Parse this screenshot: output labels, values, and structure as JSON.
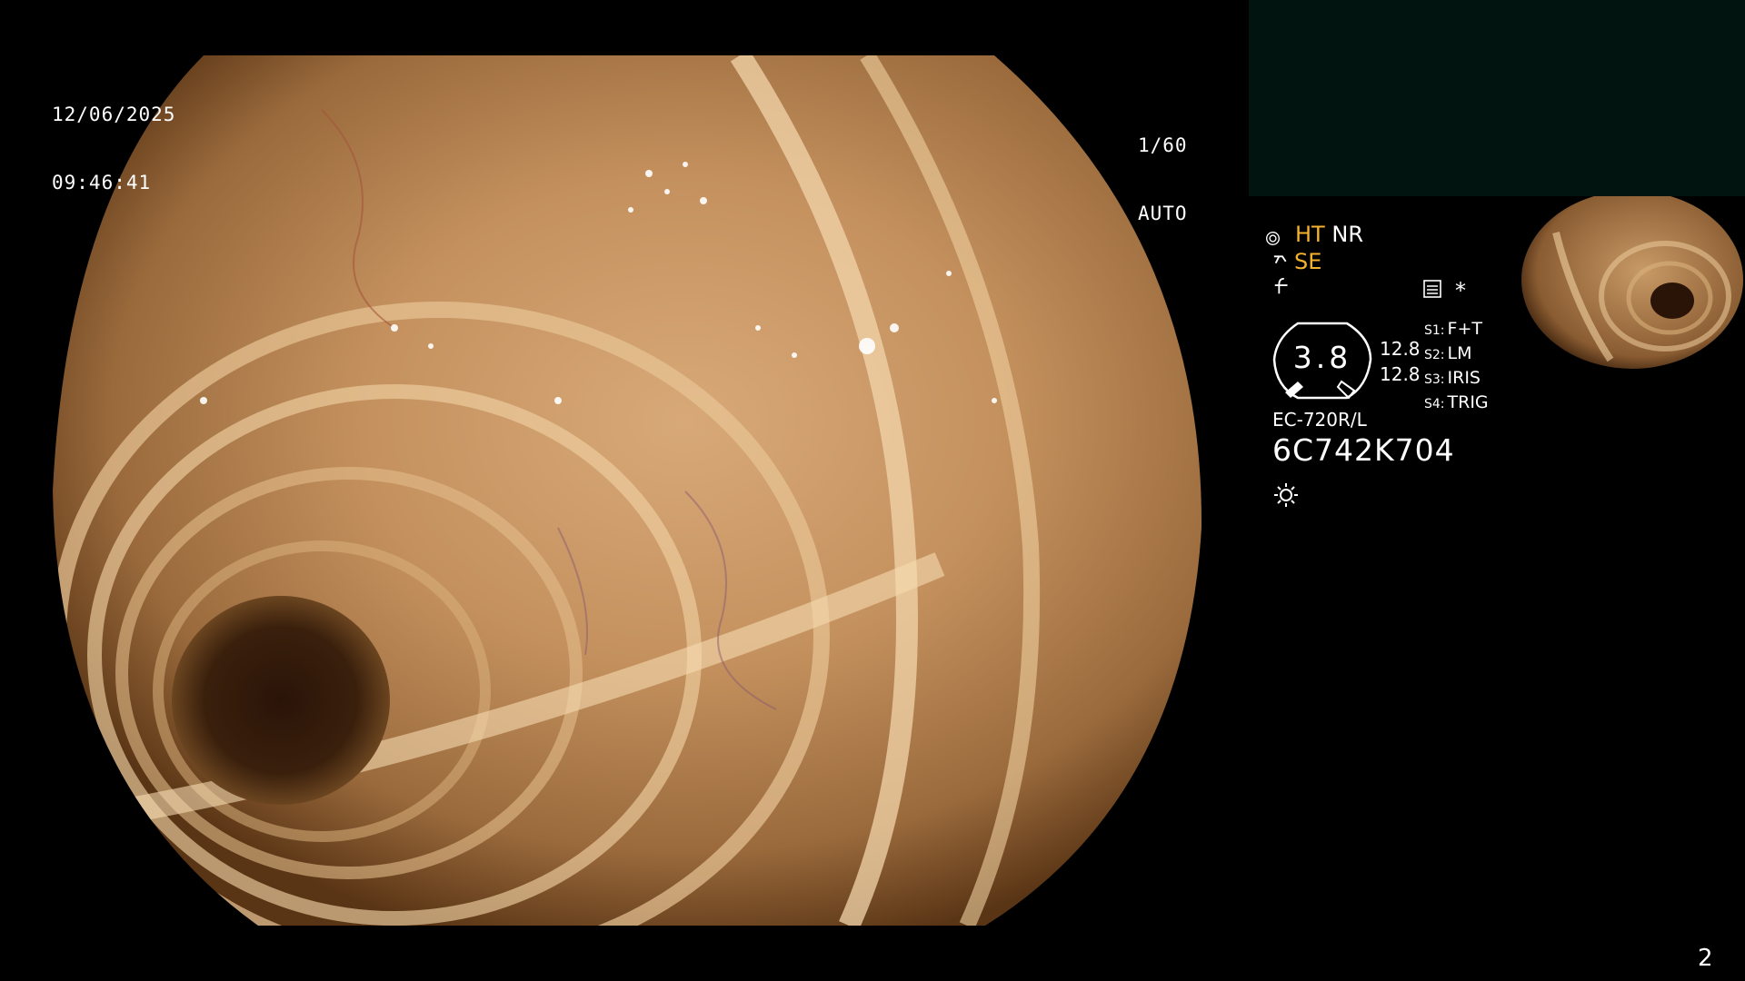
{
  "osd": {
    "date": "12/06/2025",
    "time": "09:46:41",
    "shutter": "1/60",
    "exposure": "AUTO",
    "shutter_icon": "aperture-icon",
    "exposure_icon": "iris-icon"
  },
  "settings": {
    "mode_primary": "HT",
    "mode_secondary": "NR",
    "se_label": "SE",
    "zoom": "3.8",
    "enhance": [
      "12.8",
      "12.8"
    ],
    "switches": [
      {
        "key": "S1:",
        "value": "F+T"
      },
      {
        "key": "S2:",
        "value": "LM"
      },
      {
        "key": "S3:",
        "value": "IRIS"
      },
      {
        "key": "S4:",
        "value": "TRIG"
      }
    ],
    "asterisk": "*",
    "scope_model": "EC-720R/L",
    "serial": "6C742K704"
  },
  "page": {
    "number": "2"
  },
  "colors": {
    "accent_amber": "#f5b22e",
    "pip_background": "#011410",
    "tissue": "#b98a55",
    "lumen": "#2a1408"
  },
  "icons": {
    "light": "light-source-icon",
    "record": "record-list-icon",
    "scope_tip": "scope-tip-icon",
    "freeze": "freeze-icon"
  }
}
